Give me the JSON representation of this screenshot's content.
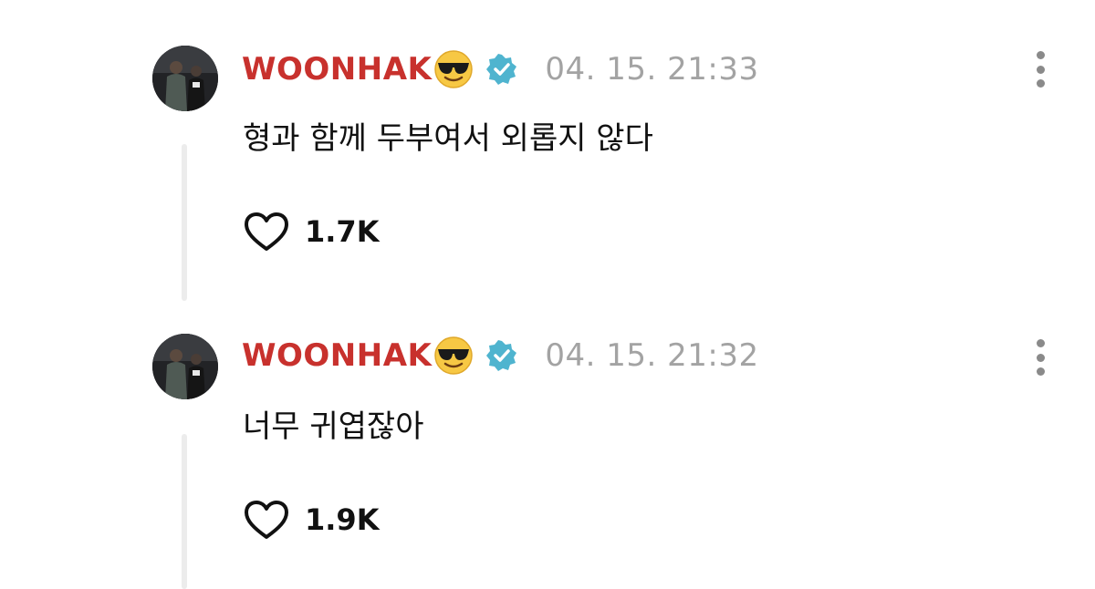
{
  "posts": [
    {
      "username": "WOONHAK",
      "username_emoji": "sunglasses-emoji",
      "verified_icon": "verified-badge-icon",
      "timestamp": "04. 15. 21:33",
      "text": "형과 함께 두부여서 외롭지 않다",
      "likes": "1.7K"
    },
    {
      "username": "WOONHAK",
      "username_emoji": "sunglasses-emoji",
      "verified_icon": "verified-badge-icon",
      "timestamp": "04. 15. 21:32",
      "text": "너무 귀엽잖아",
      "likes": "1.9K"
    }
  ],
  "colors": {
    "username": "#c8312d",
    "timestamp": "#a3a3a3",
    "verified": "#4fb4cf",
    "text": "#111111",
    "thread_line": "#ececec"
  }
}
